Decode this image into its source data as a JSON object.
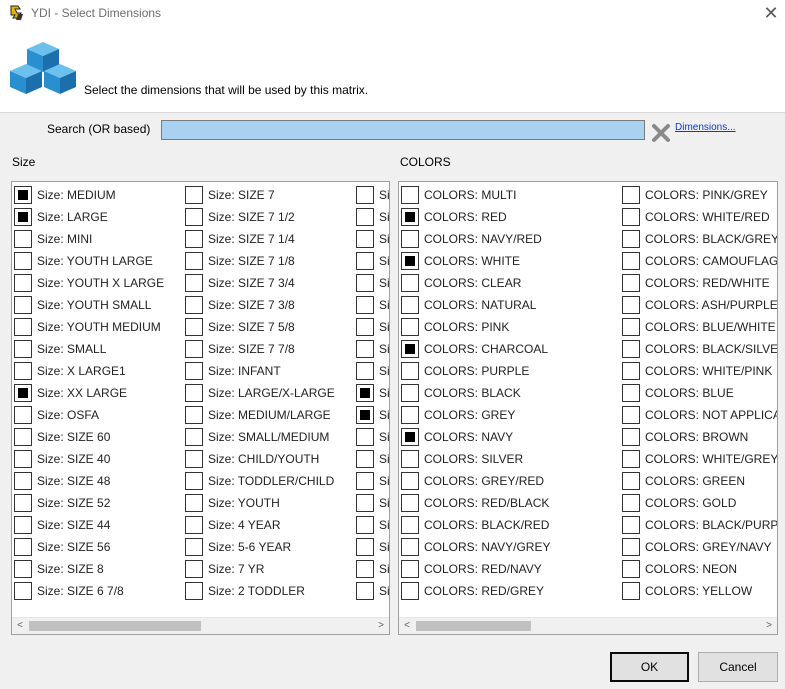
{
  "window": {
    "title": "YDI - Select Dimensions"
  },
  "header": {
    "instruction": "Select the dimensions that will be used by this matrix."
  },
  "search": {
    "label": "Search (OR based)",
    "value": "",
    "dimensions_link": "Dimensions..."
  },
  "size_group": {
    "title": "Size",
    "col1": [
      {
        "label": "Size: MEDIUM",
        "checked": true
      },
      {
        "label": "Size: LARGE",
        "checked": true
      },
      {
        "label": "Size: MINI",
        "checked": false
      },
      {
        "label": "Size: YOUTH LARGE",
        "checked": false
      },
      {
        "label": "Size: YOUTH X LARGE",
        "checked": false
      },
      {
        "label": "Size: YOUTH SMALL",
        "checked": false
      },
      {
        "label": "Size: YOUTH MEDIUM",
        "checked": false
      },
      {
        "label": "Size: SMALL",
        "checked": false
      },
      {
        "label": "Size: X LARGE1",
        "checked": false
      },
      {
        "label": "Size: XX LARGE",
        "checked": true
      },
      {
        "label": "Size: OSFA",
        "checked": false
      },
      {
        "label": "Size: SIZE 60",
        "checked": false
      },
      {
        "label": "Size: SIZE 40",
        "checked": false
      },
      {
        "label": "Size: SIZE 48",
        "checked": false
      },
      {
        "label": "Size: SIZE 52",
        "checked": false
      },
      {
        "label": "Size: SIZE 44",
        "checked": false
      },
      {
        "label": "Size: SIZE 56",
        "checked": false
      },
      {
        "label": "Size: SIZE 8",
        "checked": false
      },
      {
        "label": "Size: SIZE 6 7/8",
        "checked": false
      }
    ],
    "col2": [
      {
        "label": "Size: SIZE 7",
        "checked": false
      },
      {
        "label": "Size: SIZE 7 1/2",
        "checked": false
      },
      {
        "label": "Size: SIZE 7 1/4",
        "checked": false
      },
      {
        "label": "Size: SIZE 7 1/8",
        "checked": false
      },
      {
        "label": "Size: SIZE 7 3/4",
        "checked": false
      },
      {
        "label": "Size: SIZE 7 3/8",
        "checked": false
      },
      {
        "label": "Size: SIZE 7 5/8",
        "checked": false
      },
      {
        "label": "Size: SIZE 7 7/8",
        "checked": false
      },
      {
        "label": "Size: INFANT",
        "checked": false
      },
      {
        "label": "Size: LARGE/X-LARGE",
        "checked": false
      },
      {
        "label": "Size: MEDIUM/LARGE",
        "checked": false
      },
      {
        "label": "Size: SMALL/MEDIUM",
        "checked": false
      },
      {
        "label": "Size: CHILD/YOUTH",
        "checked": false
      },
      {
        "label": "Size: TODDLER/CHILD",
        "checked": false
      },
      {
        "label": "Size: YOUTH",
        "checked": false
      },
      {
        "label": "Size: 4 YEAR",
        "checked": false
      },
      {
        "label": "Size: 5-6 YEAR",
        "checked": false
      },
      {
        "label": "Size: 7 YR",
        "checked": false
      },
      {
        "label": "Size: 2 TODDLER",
        "checked": false
      }
    ],
    "col3": [
      {
        "label": "Si",
        "checked": false
      },
      {
        "label": "Si",
        "checked": false
      },
      {
        "label": "Si",
        "checked": false
      },
      {
        "label": "Si",
        "checked": false
      },
      {
        "label": "Si",
        "checked": false
      },
      {
        "label": "Si",
        "checked": false
      },
      {
        "label": "Si",
        "checked": false
      },
      {
        "label": "Si",
        "checked": false
      },
      {
        "label": "Si",
        "checked": false
      },
      {
        "label": "Si",
        "checked": true
      },
      {
        "label": "Si",
        "checked": true
      },
      {
        "label": "Si",
        "checked": false
      },
      {
        "label": "Si",
        "checked": false
      },
      {
        "label": "Si",
        "checked": false
      },
      {
        "label": "Si",
        "checked": false
      },
      {
        "label": "Si",
        "checked": false
      },
      {
        "label": "Si",
        "checked": false
      },
      {
        "label": "Si",
        "checked": false
      },
      {
        "label": "Si",
        "checked": false
      }
    ]
  },
  "colors_group": {
    "title": "COLORS",
    "col1": [
      {
        "label": "COLORS: MULTI",
        "checked": false
      },
      {
        "label": "COLORS: RED",
        "checked": true
      },
      {
        "label": "COLORS: NAVY/RED",
        "checked": false
      },
      {
        "label": "COLORS: WHITE",
        "checked": true
      },
      {
        "label": "COLORS: CLEAR",
        "checked": false
      },
      {
        "label": "COLORS: NATURAL",
        "checked": false
      },
      {
        "label": "COLORS: PINK",
        "checked": false
      },
      {
        "label": "COLORS: CHARCOAL",
        "checked": true
      },
      {
        "label": "COLORS: PURPLE",
        "checked": false
      },
      {
        "label": "COLORS: BLACK",
        "checked": false
      },
      {
        "label": "COLORS: GREY",
        "checked": false
      },
      {
        "label": "COLORS: NAVY",
        "checked": true
      },
      {
        "label": "COLORS: SILVER",
        "checked": false
      },
      {
        "label": "COLORS: GREY/RED",
        "checked": false
      },
      {
        "label": "COLORS: RED/BLACK",
        "checked": false
      },
      {
        "label": "COLORS: BLACK/RED",
        "checked": false
      },
      {
        "label": "COLORS: NAVY/GREY",
        "checked": false
      },
      {
        "label": "COLORS: RED/NAVY",
        "checked": false
      },
      {
        "label": "COLORS: RED/GREY",
        "checked": false
      }
    ],
    "col2": [
      {
        "label": "COLORS: PINK/GREY",
        "checked": false
      },
      {
        "label": "COLORS: WHITE/RED",
        "checked": false
      },
      {
        "label": "COLORS: BLACK/GREY",
        "checked": false
      },
      {
        "label": "COLORS: CAMOUFLAG",
        "checked": false
      },
      {
        "label": "COLORS: RED/WHITE",
        "checked": false
      },
      {
        "label": "COLORS: ASH/PURPLE",
        "checked": false
      },
      {
        "label": "COLORS: BLUE/WHITE",
        "checked": false
      },
      {
        "label": "COLORS: BLACK/SILVEI",
        "checked": false
      },
      {
        "label": "COLORS: WHITE/PINK",
        "checked": false
      },
      {
        "label": "COLORS: BLUE",
        "checked": false
      },
      {
        "label": "COLORS: NOT APPLICA",
        "checked": false
      },
      {
        "label": "COLORS: BROWN",
        "checked": false
      },
      {
        "label": "COLORS: WHITE/GREY",
        "checked": false
      },
      {
        "label": "COLORS: GREEN",
        "checked": false
      },
      {
        "label": "COLORS: GOLD",
        "checked": false
      },
      {
        "label": "COLORS: BLACK/PURPI",
        "checked": false
      },
      {
        "label": "COLORS: GREY/NAVY",
        "checked": false
      },
      {
        "label": "COLORS: NEON",
        "checked": false
      },
      {
        "label": "COLORS: YELLOW",
        "checked": false
      }
    ]
  },
  "buttons": {
    "ok": "OK",
    "cancel": "Cancel"
  },
  "colors": {
    "search_bg": "#a8d1f2",
    "link": "#0a3ad6",
    "cube_blue": "#2a8fcf"
  }
}
